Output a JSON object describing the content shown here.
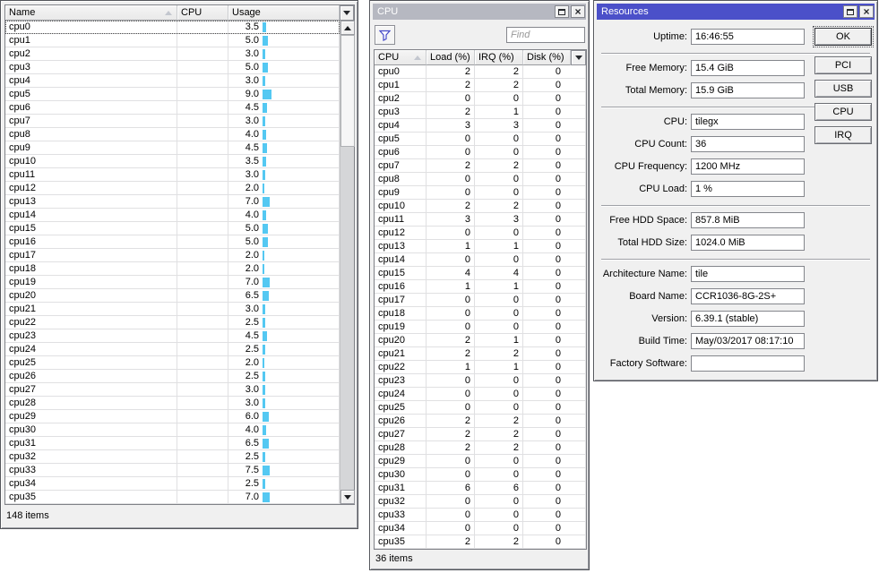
{
  "colors": {
    "titlebar_active": "#4b50c9",
    "titlebar_inactive": "#b6b8c1",
    "usage_bar": "#54c8f2",
    "window_face": "#f0f0f0"
  },
  "left_window": {
    "columns": [
      "Name",
      "CPU",
      "Usage"
    ],
    "status": "148 items",
    "rows": [
      {
        "name": "cpu0",
        "usage": 3.5
      },
      {
        "name": "cpu1",
        "usage": 5.0
      },
      {
        "name": "cpu2",
        "usage": 3.0
      },
      {
        "name": "cpu3",
        "usage": 5.0
      },
      {
        "name": "cpu4",
        "usage": 3.0
      },
      {
        "name": "cpu5",
        "usage": 9.0
      },
      {
        "name": "cpu6",
        "usage": 4.5
      },
      {
        "name": "cpu7",
        "usage": 3.0
      },
      {
        "name": "cpu8",
        "usage": 4.0
      },
      {
        "name": "cpu9",
        "usage": 4.5
      },
      {
        "name": "cpu10",
        "usage": 3.5
      },
      {
        "name": "cpu11",
        "usage": 3.0
      },
      {
        "name": "cpu12",
        "usage": 2.0
      },
      {
        "name": "cpu13",
        "usage": 7.0
      },
      {
        "name": "cpu14",
        "usage": 4.0
      },
      {
        "name": "cpu15",
        "usage": 5.0
      },
      {
        "name": "cpu16",
        "usage": 5.0
      },
      {
        "name": "cpu17",
        "usage": 2.0
      },
      {
        "name": "cpu18",
        "usage": 2.0
      },
      {
        "name": "cpu19",
        "usage": 7.0
      },
      {
        "name": "cpu20",
        "usage": 6.5
      },
      {
        "name": "cpu21",
        "usage": 3.0
      },
      {
        "name": "cpu22",
        "usage": 2.5
      },
      {
        "name": "cpu23",
        "usage": 4.5
      },
      {
        "name": "cpu24",
        "usage": 2.5
      },
      {
        "name": "cpu25",
        "usage": 2.0
      },
      {
        "name": "cpu26",
        "usage": 2.5
      },
      {
        "name": "cpu27",
        "usage": 3.0
      },
      {
        "name": "cpu28",
        "usage": 3.0
      },
      {
        "name": "cpu29",
        "usage": 6.0
      },
      {
        "name": "cpu30",
        "usage": 4.0
      },
      {
        "name": "cpu31",
        "usage": 6.5
      },
      {
        "name": "cpu32",
        "usage": 2.5
      },
      {
        "name": "cpu33",
        "usage": 7.5
      },
      {
        "name": "cpu34",
        "usage": 2.5
      },
      {
        "name": "cpu35",
        "usage": 7.0
      }
    ],
    "usage_display": [
      "3.5",
      "5.0",
      "3.0",
      "5.0",
      "3.0",
      "9.0",
      "4.5",
      "3.0",
      "4.0",
      "4.5",
      "3.5",
      "3.0",
      "2.0",
      "7.0",
      "4.0",
      "5.0",
      "5.0",
      "2.0",
      "2.0",
      "7.0",
      "6.5",
      "3.0",
      "2.5",
      "4.5",
      "2.5",
      "2.0",
      "2.5",
      "3.0",
      "3.0",
      "6.0",
      "4.0",
      "6.5",
      "2.5",
      "7.5",
      "2.5",
      "7.0"
    ]
  },
  "cpu_window": {
    "title": "CPU",
    "find_placeholder": "Find",
    "columns": [
      "CPU",
      "Load (%)",
      "IRQ (%)",
      "Disk (%)"
    ],
    "status": "36 items",
    "rows": [
      {
        "cpu": "cpu0",
        "load": 2,
        "irq": 2,
        "disk": 0
      },
      {
        "cpu": "cpu1",
        "load": 2,
        "irq": 2,
        "disk": 0
      },
      {
        "cpu": "cpu2",
        "load": 0,
        "irq": 0,
        "disk": 0
      },
      {
        "cpu": "cpu3",
        "load": 2,
        "irq": 1,
        "disk": 0
      },
      {
        "cpu": "cpu4",
        "load": 3,
        "irq": 3,
        "disk": 0
      },
      {
        "cpu": "cpu5",
        "load": 0,
        "irq": 0,
        "disk": 0
      },
      {
        "cpu": "cpu6",
        "load": 0,
        "irq": 0,
        "disk": 0
      },
      {
        "cpu": "cpu7",
        "load": 2,
        "irq": 2,
        "disk": 0
      },
      {
        "cpu": "cpu8",
        "load": 0,
        "irq": 0,
        "disk": 0
      },
      {
        "cpu": "cpu9",
        "load": 0,
        "irq": 0,
        "disk": 0
      },
      {
        "cpu": "cpu10",
        "load": 2,
        "irq": 2,
        "disk": 0
      },
      {
        "cpu": "cpu11",
        "load": 3,
        "irq": 3,
        "disk": 0
      },
      {
        "cpu": "cpu12",
        "load": 0,
        "irq": 0,
        "disk": 0
      },
      {
        "cpu": "cpu13",
        "load": 1,
        "irq": 1,
        "disk": 0
      },
      {
        "cpu": "cpu14",
        "load": 0,
        "irq": 0,
        "disk": 0
      },
      {
        "cpu": "cpu15",
        "load": 4,
        "irq": 4,
        "disk": 0
      },
      {
        "cpu": "cpu16",
        "load": 1,
        "irq": 1,
        "disk": 0
      },
      {
        "cpu": "cpu17",
        "load": 0,
        "irq": 0,
        "disk": 0
      },
      {
        "cpu": "cpu18",
        "load": 0,
        "irq": 0,
        "disk": 0
      },
      {
        "cpu": "cpu19",
        "load": 0,
        "irq": 0,
        "disk": 0
      },
      {
        "cpu": "cpu20",
        "load": 2,
        "irq": 1,
        "disk": 0
      },
      {
        "cpu": "cpu21",
        "load": 2,
        "irq": 2,
        "disk": 0
      },
      {
        "cpu": "cpu22",
        "load": 1,
        "irq": 1,
        "disk": 0
      },
      {
        "cpu": "cpu23",
        "load": 0,
        "irq": 0,
        "disk": 0
      },
      {
        "cpu": "cpu24",
        "load": 0,
        "irq": 0,
        "disk": 0
      },
      {
        "cpu": "cpu25",
        "load": 0,
        "irq": 0,
        "disk": 0
      },
      {
        "cpu": "cpu26",
        "load": 2,
        "irq": 2,
        "disk": 0
      },
      {
        "cpu": "cpu27",
        "load": 2,
        "irq": 2,
        "disk": 0
      },
      {
        "cpu": "cpu28",
        "load": 2,
        "irq": 2,
        "disk": 0
      },
      {
        "cpu": "cpu29",
        "load": 0,
        "irq": 0,
        "disk": 0
      },
      {
        "cpu": "cpu30",
        "load": 0,
        "irq": 0,
        "disk": 0
      },
      {
        "cpu": "cpu31",
        "load": 6,
        "irq": 6,
        "disk": 0
      },
      {
        "cpu": "cpu32",
        "load": 0,
        "irq": 0,
        "disk": 0
      },
      {
        "cpu": "cpu33",
        "load": 0,
        "irq": 0,
        "disk": 0
      },
      {
        "cpu": "cpu34",
        "load": 0,
        "irq": 0,
        "disk": 0
      },
      {
        "cpu": "cpu35",
        "load": 2,
        "irq": 2,
        "disk": 0
      }
    ]
  },
  "resources_window": {
    "title": "Resources",
    "groups": [
      {
        "fields": [
          {
            "label": "Uptime:",
            "value": "16:46:55"
          }
        ]
      },
      {
        "fields": [
          {
            "label": "Free Memory:",
            "value": "15.4 GiB"
          },
          {
            "label": "Total Memory:",
            "value": "15.9 GiB"
          }
        ]
      },
      {
        "fields": [
          {
            "label": "CPU:",
            "value": "tilegx"
          },
          {
            "label": "CPU Count:",
            "value": "36"
          },
          {
            "label": "CPU Frequency:",
            "value": "1200 MHz"
          },
          {
            "label": "CPU Load:",
            "value": "1 %"
          }
        ]
      },
      {
        "fields": [
          {
            "label": "Free HDD Space:",
            "value": "857.8 MiB"
          },
          {
            "label": "Total HDD Size:",
            "value": "1024.0 MiB"
          }
        ]
      },
      {
        "fields": [
          {
            "label": "Architecture Name:",
            "value": "tile"
          },
          {
            "label": "Board Name:",
            "value": "CCR1036-8G-2S+"
          },
          {
            "label": "Version:",
            "value": "6.39.1 (stable)"
          },
          {
            "label": "Build Time:",
            "value": "May/03/2017 08:17:10"
          },
          {
            "label": "Factory Software:",
            "value": ""
          }
        ]
      }
    ],
    "buttons": [
      "OK",
      "PCI",
      "USB",
      "CPU",
      "IRQ"
    ]
  }
}
